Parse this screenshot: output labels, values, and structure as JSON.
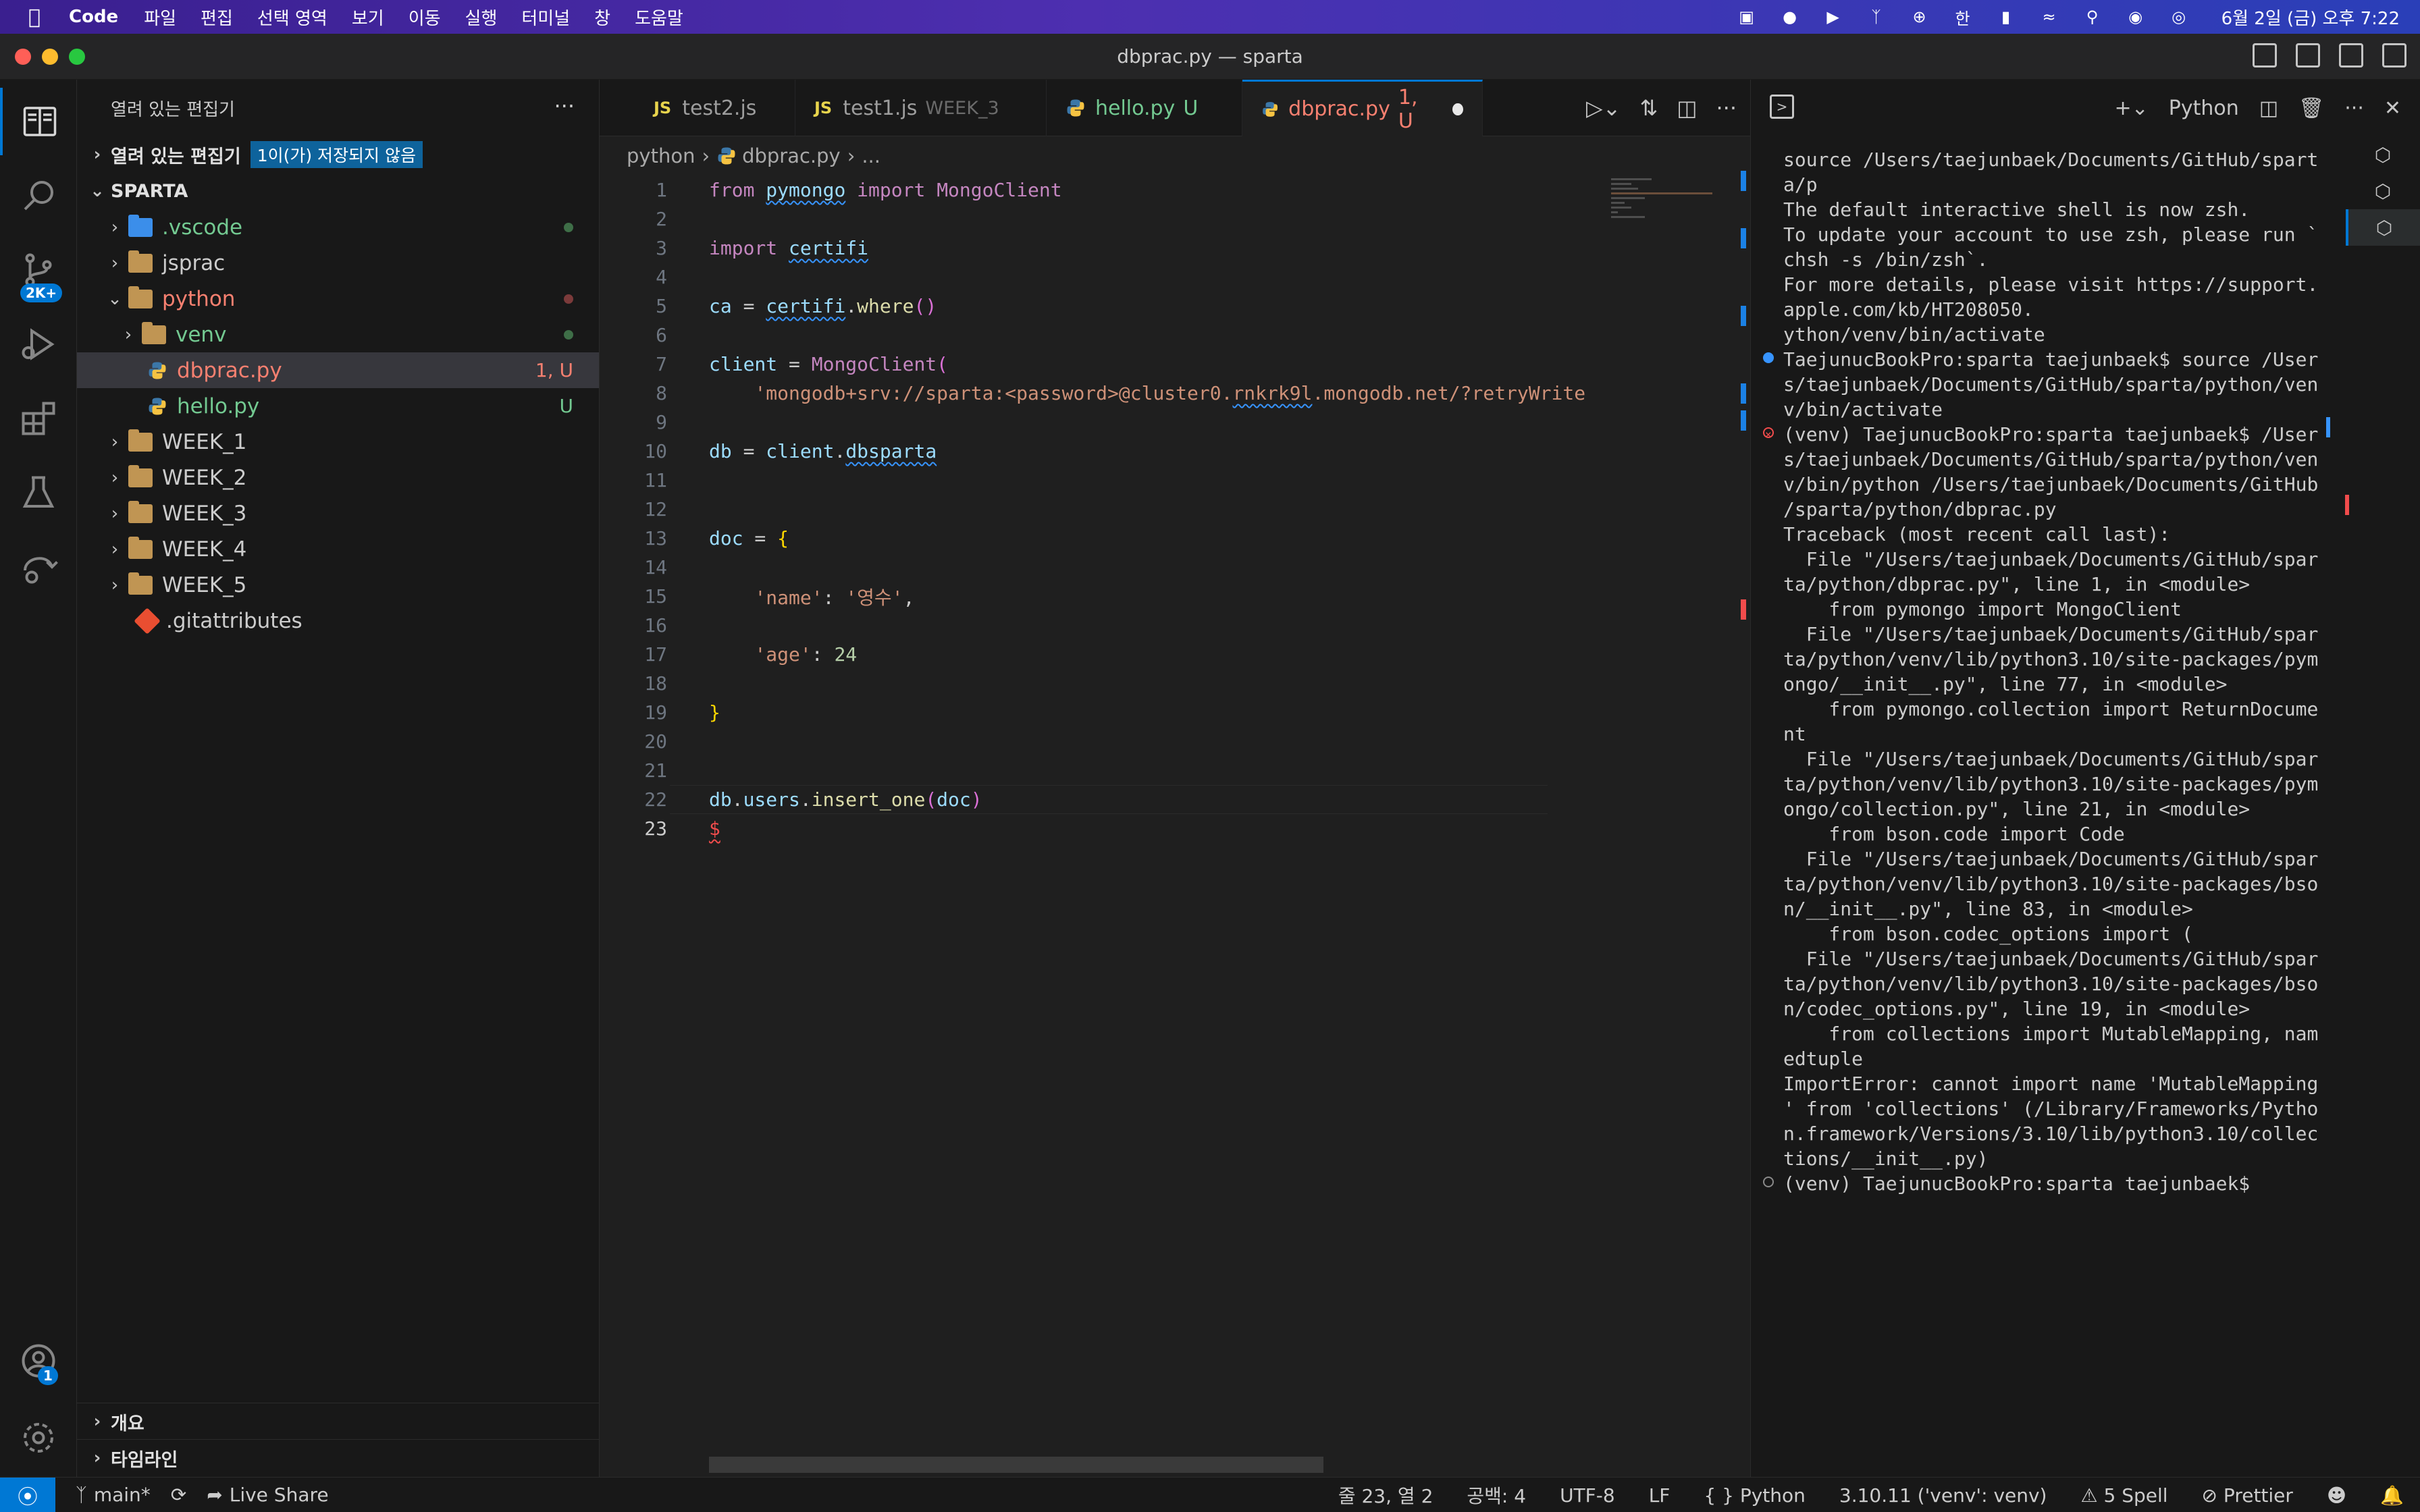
{
  "menubar": {
    "app": "Code",
    "items": [
      "파일",
      "편집",
      "선택 영역",
      "보기",
      "이동",
      "실행",
      "터미널",
      "창",
      "도움말"
    ],
    "clock": "6월 2일 (금) 오후 7:22",
    "ime": "한"
  },
  "window": {
    "title": "dbprac.py — sparta"
  },
  "activity": {
    "scm_badge": "2K+",
    "account_badge": "1"
  },
  "sidebar": {
    "header": "열려 있는 편집기",
    "open_editors": "열려 있는 편집기",
    "unsaved_badge": "1이(가) 저장되지 않음",
    "project": "SPARTA",
    "tree": [
      {
        "name": ".vscode",
        "indent": 0,
        "status": "dot-green"
      },
      {
        "name": "jsprac",
        "indent": 0,
        "status": ""
      },
      {
        "name": "python",
        "indent": 0,
        "status": "dot-red"
      },
      {
        "name": "venv",
        "indent": 1,
        "status": "dot-green"
      },
      {
        "name": "dbprac.py",
        "indent": 1,
        "status": "1, U"
      },
      {
        "name": "hello.py",
        "indent": 1,
        "status": "U"
      },
      {
        "name": "WEEK_1",
        "indent": 0,
        "status": ""
      },
      {
        "name": "WEEK_2",
        "indent": 0,
        "status": ""
      },
      {
        "name": "WEEK_3",
        "indent": 0,
        "status": ""
      },
      {
        "name": "WEEK_4",
        "indent": 0,
        "status": ""
      },
      {
        "name": "WEEK_5",
        "indent": 0,
        "status": ""
      },
      {
        "name": ".gitattributes",
        "indent": 0,
        "status": ""
      }
    ],
    "outline": "개요",
    "timeline": "타임라인"
  },
  "tabs": [
    {
      "badge": "JS",
      "label": "test2.js",
      "sub": "",
      "mod": ""
    },
    {
      "badge": "JS",
      "label": "test1.js",
      "sub": "WEEK_3",
      "mod": ""
    },
    {
      "badge": "",
      "label": "hello.py",
      "sub": "",
      "mod": "U"
    },
    {
      "badge": "",
      "label": "dbprac.py",
      "sub": "",
      "mod": "1, U"
    }
  ],
  "breadcrumb": {
    "folder": "python",
    "file": "dbprac.py",
    "rest": "..."
  },
  "code": {
    "l1_from": "from",
    "l1_mod": "pymongo",
    "l1_import": "import",
    "l1_cls": "MongoClient",
    "l3_import": "import",
    "l3_mod": "certifi",
    "l5_var": "ca",
    "l5_eq": " = ",
    "l5_mod": "certifi",
    "l5_fn": "where",
    "l7_var": "client",
    "l7_eq": " = ",
    "l7_cls": "MongoClient",
    "l8_str_a": "'mongodb+srv://sparta:<password>@cluster0.",
    "l8_str_b": "rnkrk9l",
    "l8_str_c": ".mongodb.net/?retryWrite",
    "l10_var": "db",
    "l10_eq": " = ",
    "l10_obj": "client",
    "l10_attr": "dbsparta",
    "l13_var": "doc",
    "l13_eq": " = ",
    "l15_key": "'name'",
    "l15_val": "'영수'",
    "l17_key": "'age'",
    "l17_val": "24",
    "l22_a": "db",
    "l22_b": "users",
    "l22_fn": "insert_one",
    "l22_arg": "doc",
    "l23": "$"
  },
  "terminal": {
    "shell": "Python",
    "lines": [
      "source /Users/taejunbaek/Documents/GitHub/spart",
      "a/p",
      "The default interactive shell is now zsh.",
      "To update your account to use zsh, please run `",
      "chsh -s /bin/zsh`.",
      "For more details, please visit https://support.",
      "apple.com/kb/HT208050.",
      "ython/venv/bin/activate",
      "TaejunucBookPro:sparta taejunbaek$ source /User",
      "s/taejunbaek/Documents/GitHub/sparta/python/ven",
      "v/bin/activate",
      "(venv) TaejunucBookPro:sparta taejunbaek$ /User",
      "s/taejunbaek/Documents/GitHub/sparta/python/ven",
      "v/bin/python /Users/taejunbaek/Documents/GitHub",
      "/sparta/python/dbprac.py",
      "Traceback (most recent call last):",
      "  File \"/Users/taejunbaek/Documents/GitHub/spar",
      "ta/python/dbprac.py\", line 1, in <module>",
      "    from pymongo import MongoClient",
      "  File \"/Users/taejunbaek/Documents/GitHub/spar",
      "ta/python/venv/lib/python3.10/site-packages/pym",
      "ongo/__init__.py\", line 77, in <module>",
      "    from pymongo.collection import ReturnDocume",
      "nt",
      "  File \"/Users/taejunbaek/Documents/GitHub/spar",
      "ta/python/venv/lib/python3.10/site-packages/pym",
      "ongo/collection.py\", line 21, in <module>",
      "    from bson.code import Code",
      "  File \"/Users/taejunbaek/Documents/GitHub/spar",
      "ta/python/venv/lib/python3.10/site-packages/bso",
      "n/__init__.py\", line 83, in <module>",
      "    from bson.codec_options import (",
      "  File \"/Users/taejunbaek/Documents/GitHub/spar",
      "ta/python/venv/lib/python3.10/site-packages/bso",
      "n/codec_options.py\", line 19, in <module>",
      "    from collections import MutableMapping, nam",
      "edtuple",
      "ImportError: cannot import name 'MutableMapping",
      "' from 'collections' (/Library/Frameworks/Pytho",
      "n.framework/Versions/3.10/lib/python3.10/collec",
      "tions/__init__.py)",
      "(venv) TaejunucBookPro:sparta taejunbaek$"
    ]
  },
  "status": {
    "branch": "main*",
    "liveshare": "Live Share",
    "position": "줄 23, 열 2",
    "spaces": "공백: 4",
    "encoding": "UTF-8",
    "eol": "LF",
    "language": "Python",
    "interpreter": "3.10.11 ('venv': venv)",
    "spell": "5 Spell",
    "prettier": "Prettier"
  }
}
